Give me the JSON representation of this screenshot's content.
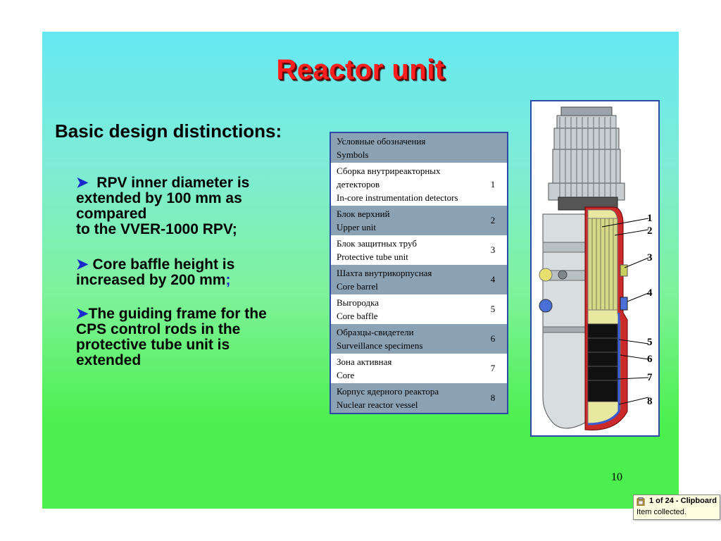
{
  "slide": {
    "title": "Reactor unit",
    "subtitle": "Basic design distinctions:",
    "bullets": [
      {
        "arrow": "➤",
        "lines": [
          "RPV inner diameter is",
          "extended by 100 mm as",
          "compared",
          "to the VVER-1000 RPV;"
        ]
      },
      {
        "arrow": "➤",
        "lines": [
          "Core baffle height is",
          "increased by 200 mm"
        ],
        "tail": ";"
      },
      {
        "arrow": "➤",
        "lines": [
          "The guiding frame for the",
          "CPS control rods in the",
          "protective tube unit is",
          "extended"
        ]
      }
    ],
    "page_number": "10"
  },
  "legend": {
    "header": [
      "Условные обозначения",
      "Symbols"
    ],
    "rows": [
      {
        "lines": [
          "Сборка внутриреакторных",
          "детекторов",
          "In-core instrumentation detectors"
        ],
        "num": "1",
        "shaded": false
      },
      {
        "lines": [
          "Блок верхний",
          "Upper unit"
        ],
        "num": "2",
        "shaded": true
      },
      {
        "lines": [
          "Блок защитных труб",
          "Protective tube unit"
        ],
        "num": "3",
        "shaded": false
      },
      {
        "lines": [
          "Шахта внутрикорпусная",
          "Core barrel"
        ],
        "num": "4",
        "shaded": true
      },
      {
        "lines": [
          "Выгородка",
          "Core baffle"
        ],
        "num": "5",
        "shaded": false
      },
      {
        "lines": [
          "Образцы-свидетели",
          "Surveillance specimens"
        ],
        "num": "6",
        "shaded": true
      },
      {
        "lines": [
          "Зона активная",
          "Core"
        ],
        "num": "7",
        "shaded": false
      },
      {
        "lines": [
          "Корпус ядерного реактора",
          "Nuclear reactor vessel"
        ],
        "num": "8",
        "shaded": true
      }
    ]
  },
  "drawing": {
    "callouts": [
      "1",
      "2",
      "3",
      "4",
      "5",
      "6",
      "7",
      "8"
    ]
  },
  "clipboard": {
    "title": "1 of 24 - Clipboard",
    "message": "Item collected."
  },
  "colors": {
    "title": "#ff1f1f",
    "arrow": "#1a2acc",
    "legend_shade": "#8aa2b4",
    "frame": "#2c4aa8"
  }
}
